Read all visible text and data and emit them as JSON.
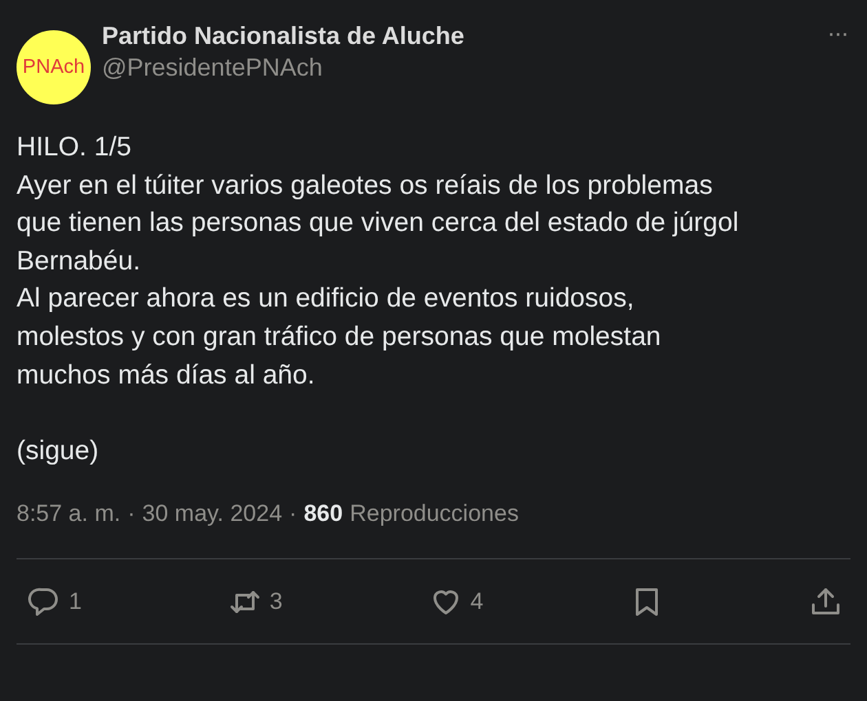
{
  "author": {
    "avatar_text": "PNAch",
    "name": "Partido Nacionalista de Aluche",
    "handle": "@PresidentePNAch"
  },
  "more_label": "···",
  "text": "HILO. 1/5\nAyer en el túiter varios galeotes os reíais de los problemas\nque tienen las personas que viven cerca del estado de júrgol\nBernabéu.\nAl parecer ahora es un edificio de eventos ruidosos,\nmolestos y con gran tráfico de personas que molestan\nmuchos más días al año.\n\n(sigue)",
  "meta": {
    "separator": "·",
    "time": "8:57 a. m.",
    "date": "30 may. 2024",
    "views_count": "860",
    "views_label": "Reproducciones"
  },
  "actions": [
    {
      "kind": "reply",
      "count": "1"
    },
    {
      "kind": "repost",
      "count": "3"
    },
    {
      "kind": "like",
      "count": "4"
    },
    {
      "kind": "bookmark"
    },
    {
      "kind": "share"
    }
  ]
}
